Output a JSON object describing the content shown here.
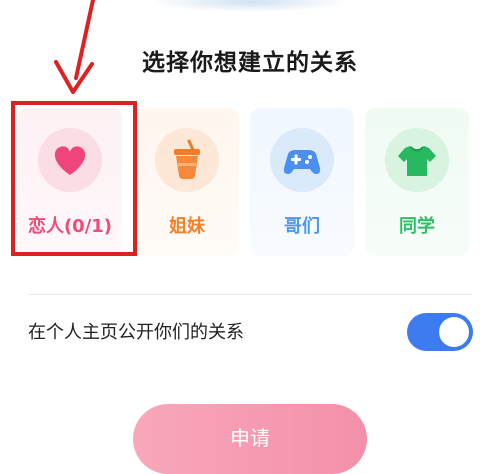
{
  "dialog": {
    "title": "选择你想建立的关系",
    "relations": [
      {
        "key": "lovers",
        "label": "恋人(0/1)",
        "icon": "heart-icon",
        "color": "#ee4d79",
        "selected": true
      },
      {
        "key": "sisters",
        "label": "姐妹",
        "icon": "drink-cup-icon",
        "color": "#f5822a",
        "selected": false
      },
      {
        "key": "brothers",
        "label": "哥们",
        "icon": "gamepad-icon",
        "color": "#4d98ee",
        "selected": false
      },
      {
        "key": "classmates",
        "label": "同学",
        "icon": "tshirt-icon",
        "color": "#2fbf67",
        "selected": false
      }
    ],
    "public_setting": {
      "label": "在个人主页公开你们的关系",
      "enabled": true,
      "toggle_color": "#3c7cf0"
    },
    "apply_button": {
      "label": "申请",
      "color": "#f59ab0"
    }
  }
}
